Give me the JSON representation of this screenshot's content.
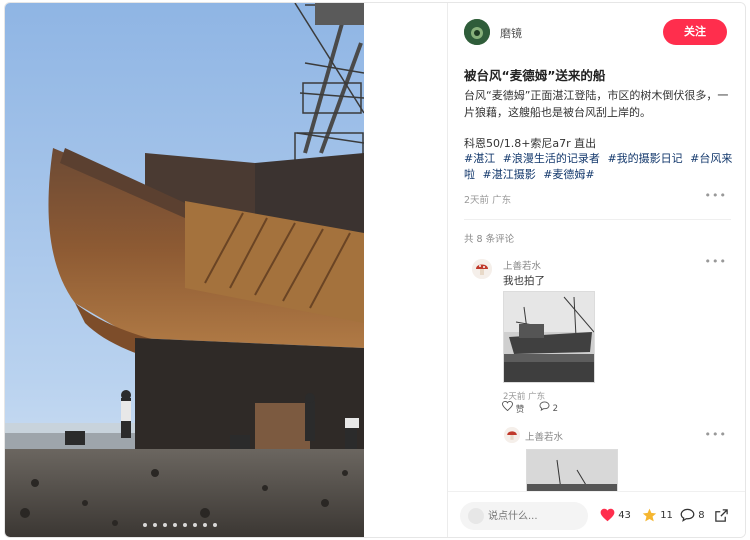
{
  "post": {
    "author": "磨镜",
    "follow_label": "关注",
    "title": "被台风“麦德姆”送来的船",
    "body": "台风“麦德姆”正面湛江登陆，市区的树木倒伏很多，一片狼藉，这艘船也是被台风刮上岸的。",
    "camera": "科恩50/1.8+索尼a7r  直出",
    "tags": [
      "#湛江",
      "#浪漫生活的记录者",
      "#我的摄影日记",
      "#台风来啦",
      "#湛江摄影",
      "#麦德姆#"
    ],
    "meta": "2天前 广东"
  },
  "comments": {
    "count_label": "共 8 条评论",
    "items": [
      {
        "author": "上善若水",
        "text": "我也拍了",
        "meta": "2天前 广东",
        "like_label": "赞",
        "reply_count": "2"
      },
      {
        "author": "上善若水"
      }
    ]
  },
  "footer": {
    "input_placeholder": "说点什么...",
    "likes": "43",
    "stars": "11",
    "comments": "8"
  },
  "colors": {
    "accent": "#ff2e4d",
    "tag": "#13386c",
    "like_heart": "#ff2e4d",
    "star": "#f5b630"
  },
  "icons": {
    "more": "more-dots-icon",
    "like": "heart-icon",
    "star": "star-icon",
    "comment": "comment-bubble-icon",
    "share": "share-icon",
    "pen": "pen-icon"
  }
}
